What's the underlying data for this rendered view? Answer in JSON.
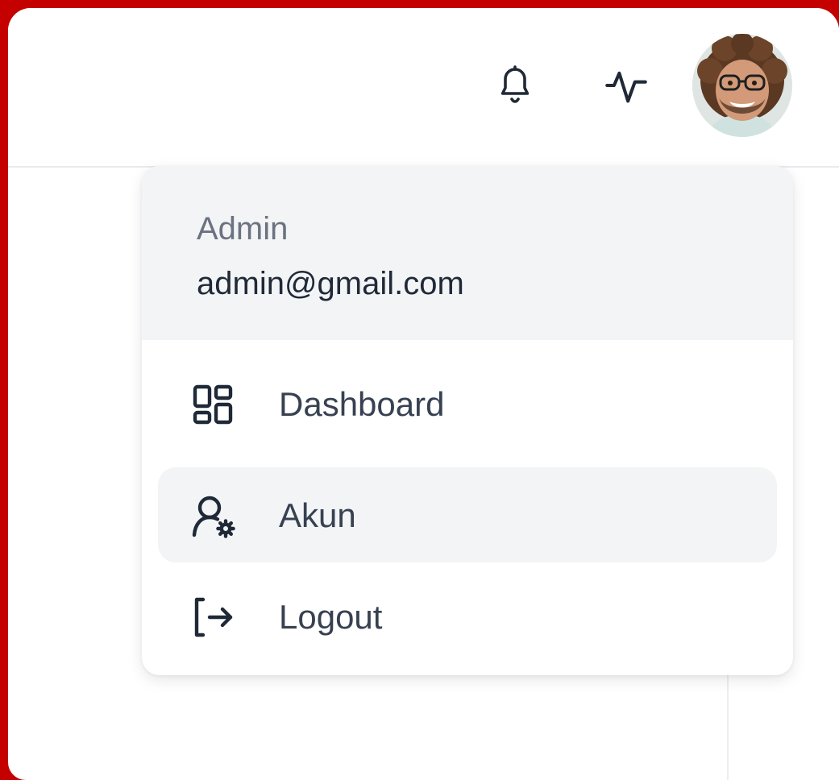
{
  "header": {
    "icons": [
      "bell-icon",
      "activity-icon"
    ],
    "avatar": "user-avatar"
  },
  "user_menu": {
    "name": "Admin",
    "email": "admin@gmail.com",
    "items": [
      {
        "label": "Dashboard",
        "icon": "dashboard-grid-icon",
        "active": false
      },
      {
        "label": "Akun",
        "icon": "user-settings-icon",
        "active": true
      },
      {
        "label": "Logout",
        "icon": "logout-icon",
        "active": false
      }
    ]
  },
  "colors": {
    "frame": "#c40000",
    "menu_header_bg": "#f3f4f6",
    "active_item_bg": "#f3f4f6",
    "text_primary": "#1f2937",
    "text_muted": "#6b7280"
  }
}
